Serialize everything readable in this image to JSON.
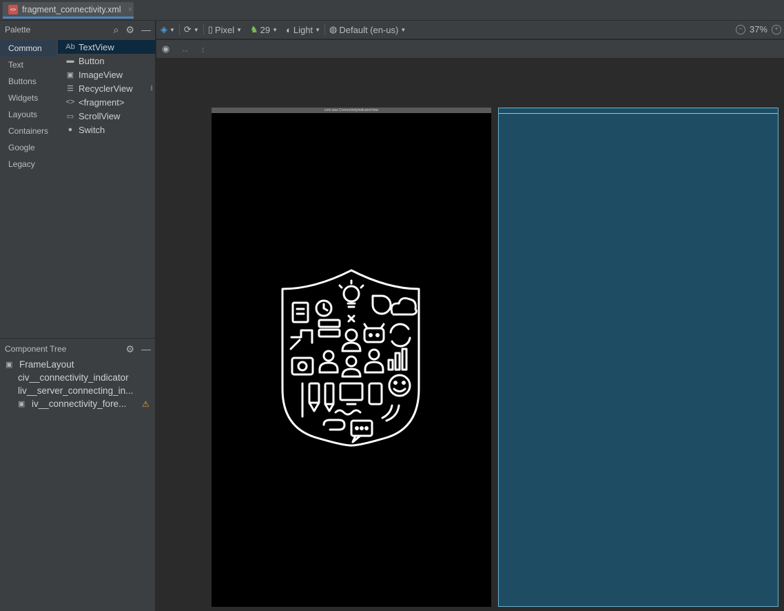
{
  "tab": {
    "filename": "fragment_connectivity.xml",
    "close": "×"
  },
  "palette": {
    "title": "Palette",
    "categories": [
      "Common",
      "Text",
      "Buttons",
      "Widgets",
      "Layouts",
      "Containers",
      "Google",
      "Legacy"
    ],
    "items": [
      {
        "icon": "Ab",
        "label": "TextView"
      },
      {
        "icon": "▬",
        "label": "Button"
      },
      {
        "icon": "▣",
        "label": "ImageView"
      },
      {
        "icon": "☰",
        "label": "RecyclerView"
      },
      {
        "icon": "<>",
        "label": "<fragment>"
      },
      {
        "icon": "▭",
        "label": "ScrollView"
      },
      {
        "icon": "●",
        "label": "Switch"
      }
    ]
  },
  "component_tree": {
    "title": "Component Tree",
    "nodes": [
      {
        "label": "FrameLayout"
      },
      {
        "label": "civ__connectivity_indicator"
      },
      {
        "label": "liv__server_connecting_in..."
      },
      {
        "label": "iv__connectivity_fore..."
      }
    ]
  },
  "toolbar": {
    "device": "Pixel",
    "api": "29",
    "theme": "Light",
    "locale": "Default (en-us)",
    "zoom": "37%"
  },
  "canvas": {
    "phone_top_label": "com.waz.ConnectivityIndicatorView"
  },
  "colors": {
    "accent": "#4a88c7",
    "blueprint": "#1e4d63",
    "warning": "#e2a53a"
  }
}
